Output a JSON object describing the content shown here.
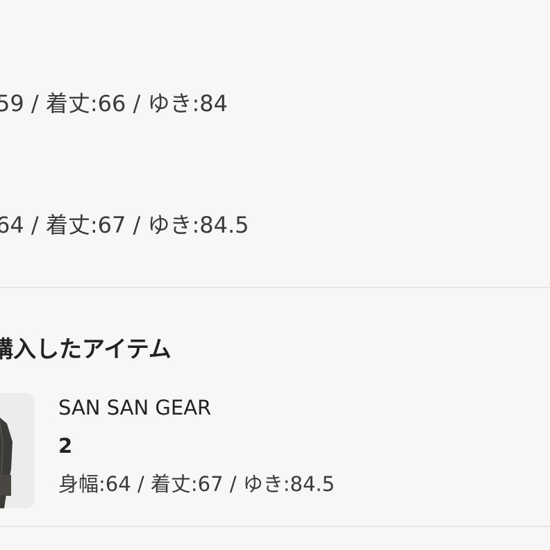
{
  "review_entries": [
    {
      "measurements": "59 / 着丈:66 / ゆき:84"
    },
    {
      "measurements": "64 / 着丈:67 / ゆき:84.5"
    }
  ],
  "purchased_section": {
    "title": "購入したアイテム",
    "item": {
      "image_icon": "product-photo-icon",
      "brand": "SAN SAN GEAR",
      "size": "2",
      "measurements": "身幅:64 / 着丈:67 / ゆき:84.5"
    }
  },
  "colors": {
    "background": "#f7f7f7",
    "divider": "#e4e4e4",
    "text": "#222222"
  }
}
